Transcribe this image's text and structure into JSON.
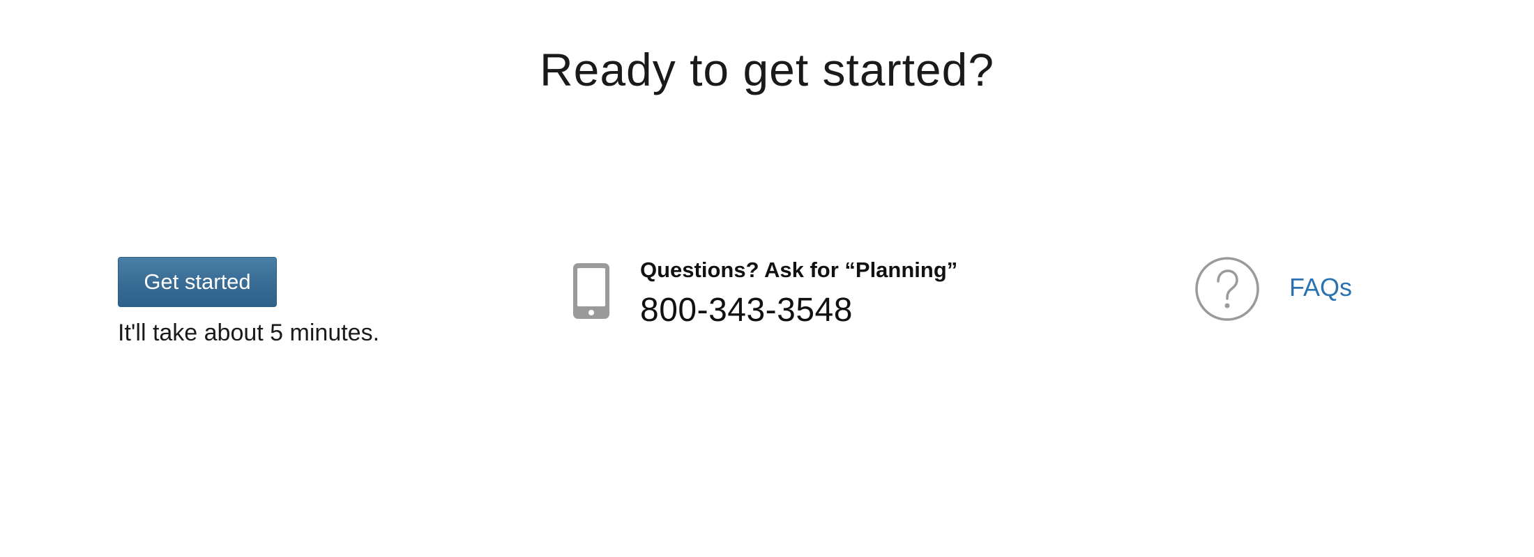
{
  "header": {
    "title": "Ready to get started?"
  },
  "cta": {
    "button_label": "Get started",
    "note": "It'll take about 5 minutes."
  },
  "contact": {
    "icon": "mobile-phone-icon",
    "question": "Questions? Ask for “Planning”",
    "phone": "800-343-3548"
  },
  "faq": {
    "icon": "question-circle-icon",
    "link_label": "FAQs"
  },
  "colors": {
    "button": "#3a6d95",
    "link": "#2a72b0",
    "icon": "#9a9a9a"
  }
}
